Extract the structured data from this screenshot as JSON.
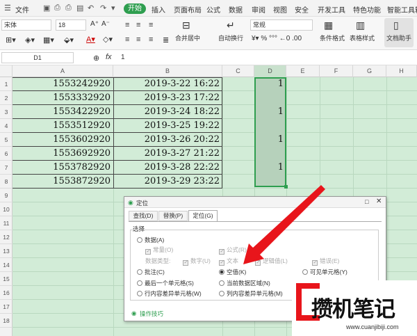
{
  "menubar": {
    "file": "文件",
    "tabs": [
      "开始",
      "插入",
      "页面布局",
      "公式",
      "数据",
      "审阅",
      "视图",
      "安全",
      "开发工具",
      "特色功能",
      "智能工具箱"
    ]
  },
  "toolbar": {
    "font_name": "宋体",
    "font_size": "18",
    "merge": "合并居中",
    "wrap": "自动换行",
    "format": "常规",
    "cond_format": "条件格式",
    "table_style": "表格样式",
    "doc_helper": "文档助手"
  },
  "formula": {
    "name_box": "D1",
    "fx": "fx",
    "value": "1"
  },
  "columns": [
    "A",
    "B",
    "C",
    "D",
    "E",
    "F",
    "G",
    "H"
  ],
  "rows": [
    "1",
    "2",
    "3",
    "4",
    "5",
    "6",
    "7",
    "8",
    "9",
    "10",
    "11",
    "12",
    "13",
    "14",
    "15",
    "16",
    "17",
    "18"
  ],
  "data": {
    "a": [
      "1553242920",
      "1553332920",
      "1553422920",
      "1553512920",
      "1553602920",
      "1553692920",
      "1553782920",
      "1553872920"
    ],
    "b": [
      "2019-3-22  16:22",
      "2019-3-23  17:22",
      "2019-3-24  18:22",
      "2019-3-25  19:22",
      "2019-3-26  20:22",
      "2019-3-27  21:22",
      "2019-3-28  22:22",
      "2019-3-29  23:22"
    ],
    "d": [
      "1",
      "",
      "1",
      "",
      "1",
      "",
      "1",
      ""
    ]
  },
  "dialog": {
    "title": "定位",
    "tabs": [
      "查找(D)",
      "替换(P)",
      "定位(G)"
    ],
    "group": "选择",
    "opt_data": "数据(A)",
    "chk_const": "常量(O)",
    "chk_formula": "公式(R)",
    "data_type": "数据类型:",
    "chk_number": "数字(U)",
    "chk_text": "文本",
    "chk_logic": "逻辑值(L)",
    "chk_error": "错误(E)",
    "opt_comment": "批注(C)",
    "opt_blank": "空值(K)",
    "opt_visible": "可见单元格(Y)",
    "opt_last": "最后一个单元格(S)",
    "opt_region": "当前数据区域(N)",
    "opt_rowdiff": "行内容差异单元格(W)",
    "opt_coldiff": "列内容差异单元格(M)",
    "tips": "操作技巧"
  },
  "watermark": {
    "title": "攒机笔记",
    "url": "www.cuanjibiji.com"
  }
}
